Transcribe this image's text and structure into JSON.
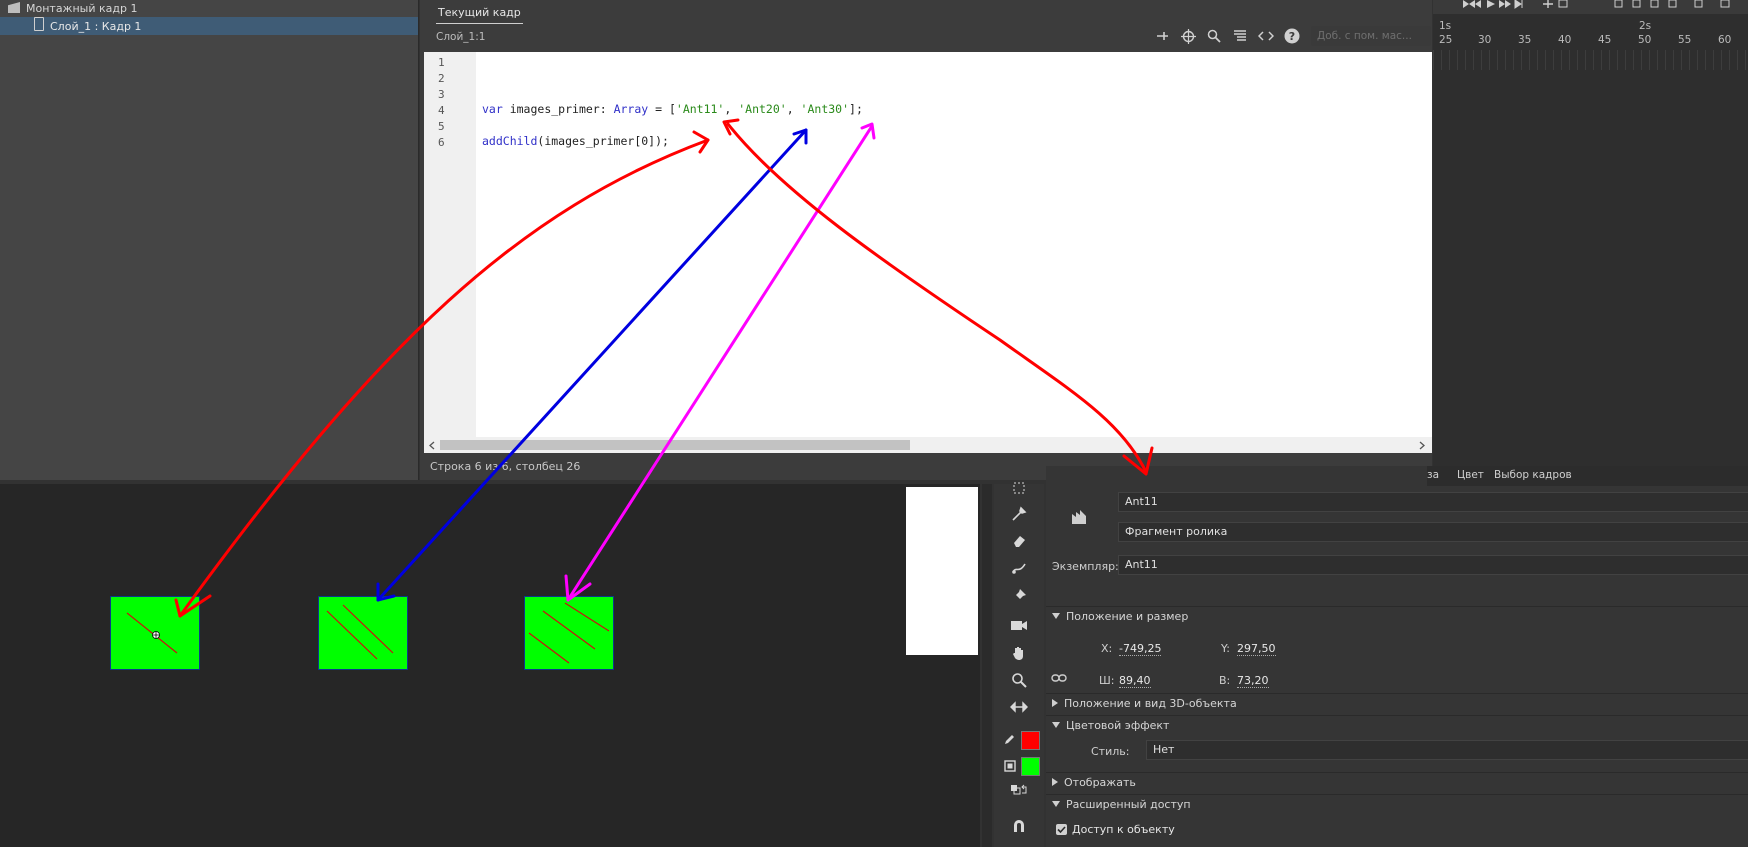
{
  "actions_panel": {
    "scene_label": "Монтажный кадр 1",
    "layer_label": "Слой_1 : Кадр 1"
  },
  "editor": {
    "tab_label": "Текущий кадр",
    "location": "Слой_1:1",
    "snippet_placeholder": "Доб. с пом. мас...",
    "line_numbers": [
      "1",
      "2",
      "3",
      "4",
      "5",
      "6"
    ],
    "code": {
      "line4": {
        "kw_var": "var",
        "ident": " images_primer: ",
        "type": "Array",
        "op": " = [",
        "s1": "'Ant11'",
        "sep1": ", ",
        "s2": "'Ant20'",
        "sep2": ", ",
        "s3": "'Ant30'",
        "close": "];"
      },
      "line6": {
        "fn": "addChild",
        "args": "(images_primer[0]);"
      }
    },
    "status": "Строка 6 из 6, столбец 26"
  },
  "timeline": {
    "seconds": [
      "1s",
      "2s"
    ],
    "frame_numbers": [
      "25",
      "30",
      "35",
      "40",
      "45",
      "50",
      "55",
      "60"
    ]
  },
  "tools": {
    "icons": [
      "free-transform-icon",
      "eyedropper-icon",
      "eraser-icon",
      "asset-warp-icon",
      "pin-icon",
      "camera-icon",
      "hand-icon",
      "zoom-icon",
      "width-arrows-icon",
      "stroke-pencil-icon",
      "fill-bucket-icon",
      "swap-colors-icon",
      "snap-magnet-icon"
    ],
    "stroke_color": "#ff0000",
    "fill_color": "#00ff00"
  },
  "properties": {
    "tabs": [
      "за",
      "Цвет",
      "Выбор кадров"
    ],
    "symbol_name": "Ant11",
    "symbol_type": "Фрагмент ролика",
    "instance_label": "Экземпляр:",
    "instance_value": "Ant11",
    "position_section": "Положение и размер",
    "x_label": "X:",
    "x_value": "-749,25",
    "y_label": "Y:",
    "y_value": "297,50",
    "w_label": "Ш:",
    "w_value": "89,40",
    "h_label": "В:",
    "h_value": "73,20",
    "section_3d": "Положение и вид 3D-объекта",
    "section_color": "Цветовой эффект",
    "style_label": "Стиль:",
    "style_value": "Нет",
    "section_display": "Отображать",
    "section_access": "Расширенный доступ",
    "access_checkbox_label": "Доступ к объекту"
  },
  "annotation_colors": {
    "ant11": "#ff0000",
    "ant20": "#0000e0",
    "ant30": "#ff00ff"
  }
}
